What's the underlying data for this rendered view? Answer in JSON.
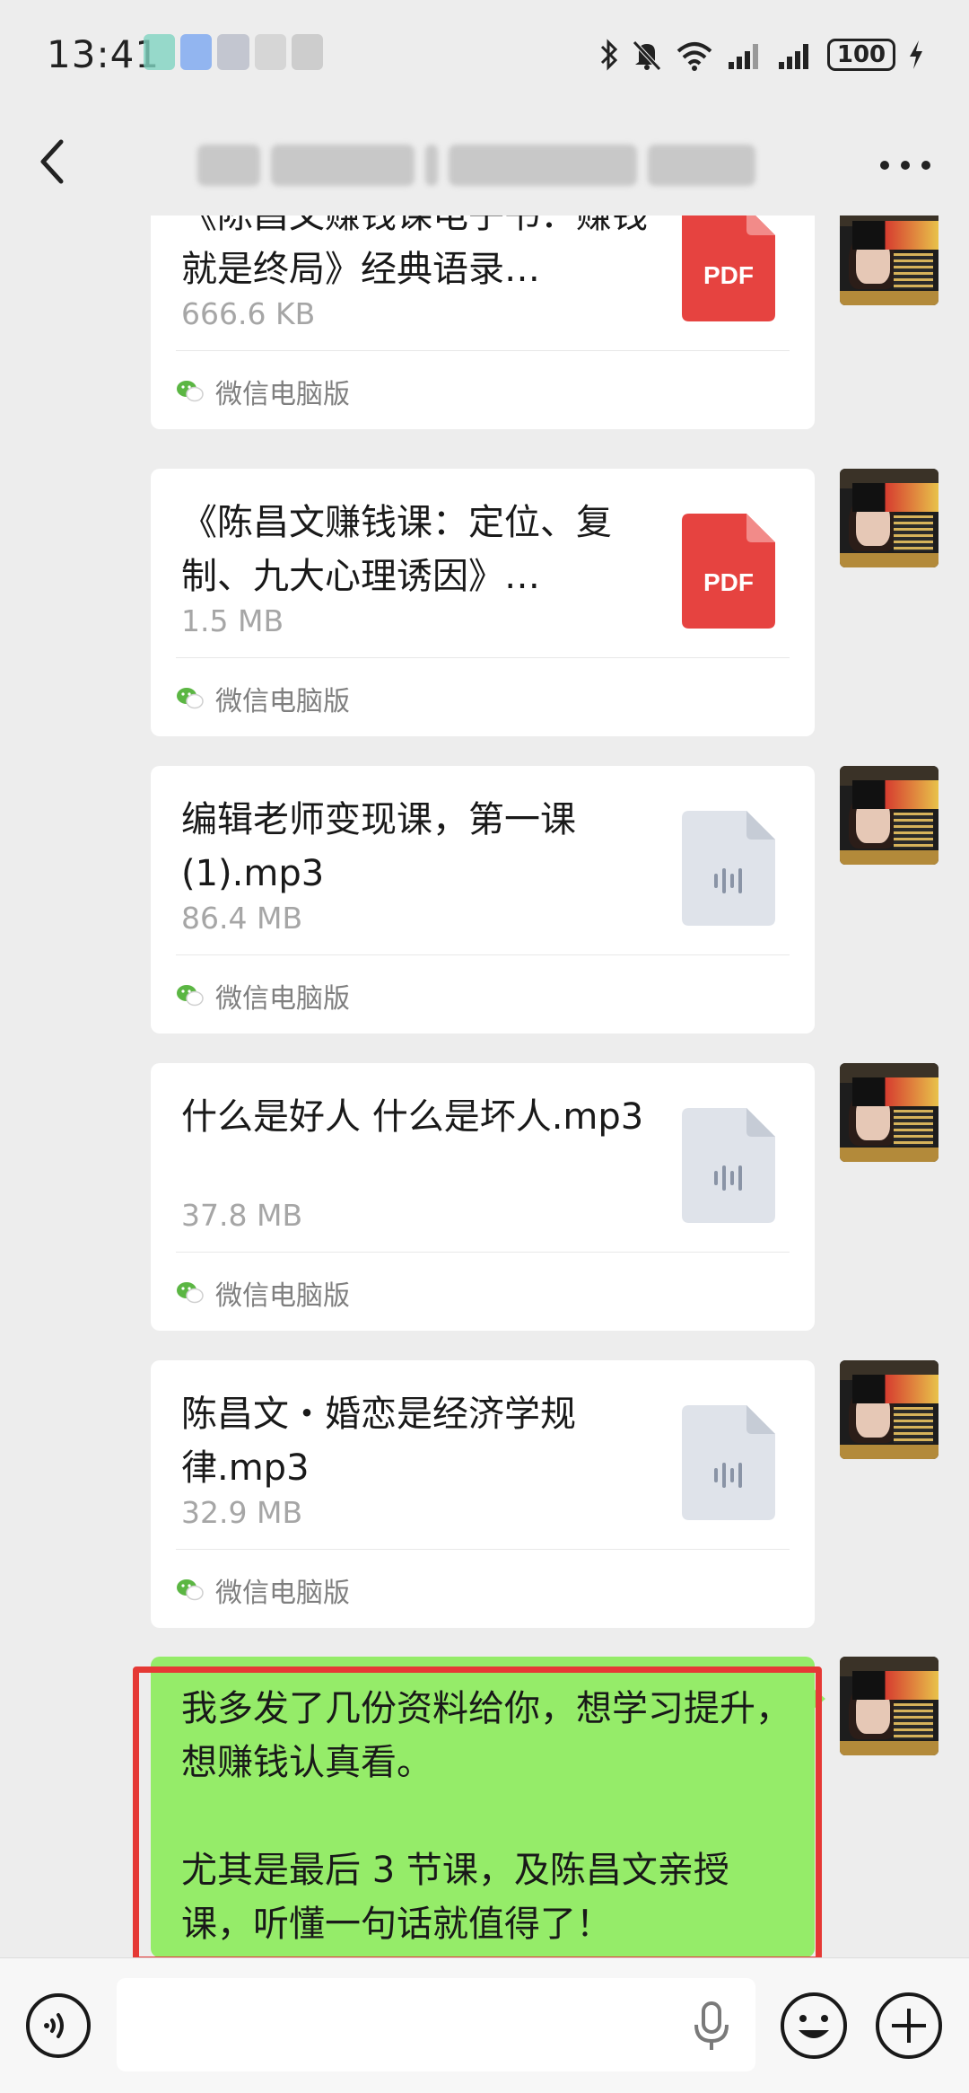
{
  "status_bar": {
    "time": "13:41",
    "battery": "100",
    "icons": [
      "bluetooth-icon",
      "mute-icon",
      "wifi-icon",
      "signal-icon",
      "signal-icon",
      "charging-icon"
    ]
  },
  "title_bar": {
    "back_icon": "chevron-left-icon",
    "more_icon": "more-icon"
  },
  "messages": [
    {
      "type": "file",
      "name": "《陈昌文赚钱课电子书：赚钱就是终局》经典语录…",
      "size": "666.6 KB",
      "icon": "pdf-icon",
      "icon_label": "PDF",
      "source": "微信电脑版"
    },
    {
      "type": "file",
      "name": "《陈昌文赚钱课：定位、复制、九大心理诱因》…",
      "size": "1.5 MB",
      "icon": "pdf-icon",
      "icon_label": "PDF",
      "source": "微信电脑版"
    },
    {
      "type": "file",
      "name": "编辑老师变现课，第一课(1).mp3",
      "size": "86.4 MB",
      "icon": "audio-file-icon",
      "source": "微信电脑版"
    },
    {
      "type": "file",
      "name": "什么是好人 什么是坏人.mp3",
      "size": "37.8 MB",
      "icon": "audio-file-icon",
      "source": "微信电脑版"
    },
    {
      "type": "file",
      "name": "陈昌文・婚恋是经济学规律.mp3",
      "size": "32.9 MB",
      "icon": "audio-file-icon",
      "source": "微信电脑版"
    },
    {
      "type": "text",
      "text": "我多发了几份资料给你，想学习提升，想赚钱认真看。\n\n尤其是最后 3 节课，及陈昌文亲授课，听懂一句话就值得了！"
    }
  ],
  "colors": {
    "background": "#ededed",
    "sent_bubble": "#95ec69",
    "pdf_red": "#e64340",
    "highlight": "#e53935"
  },
  "input_bar": {
    "placeholder": "",
    "icons": [
      "voice-icon",
      "mic-icon",
      "emoji-icon",
      "plus-icon"
    ]
  }
}
